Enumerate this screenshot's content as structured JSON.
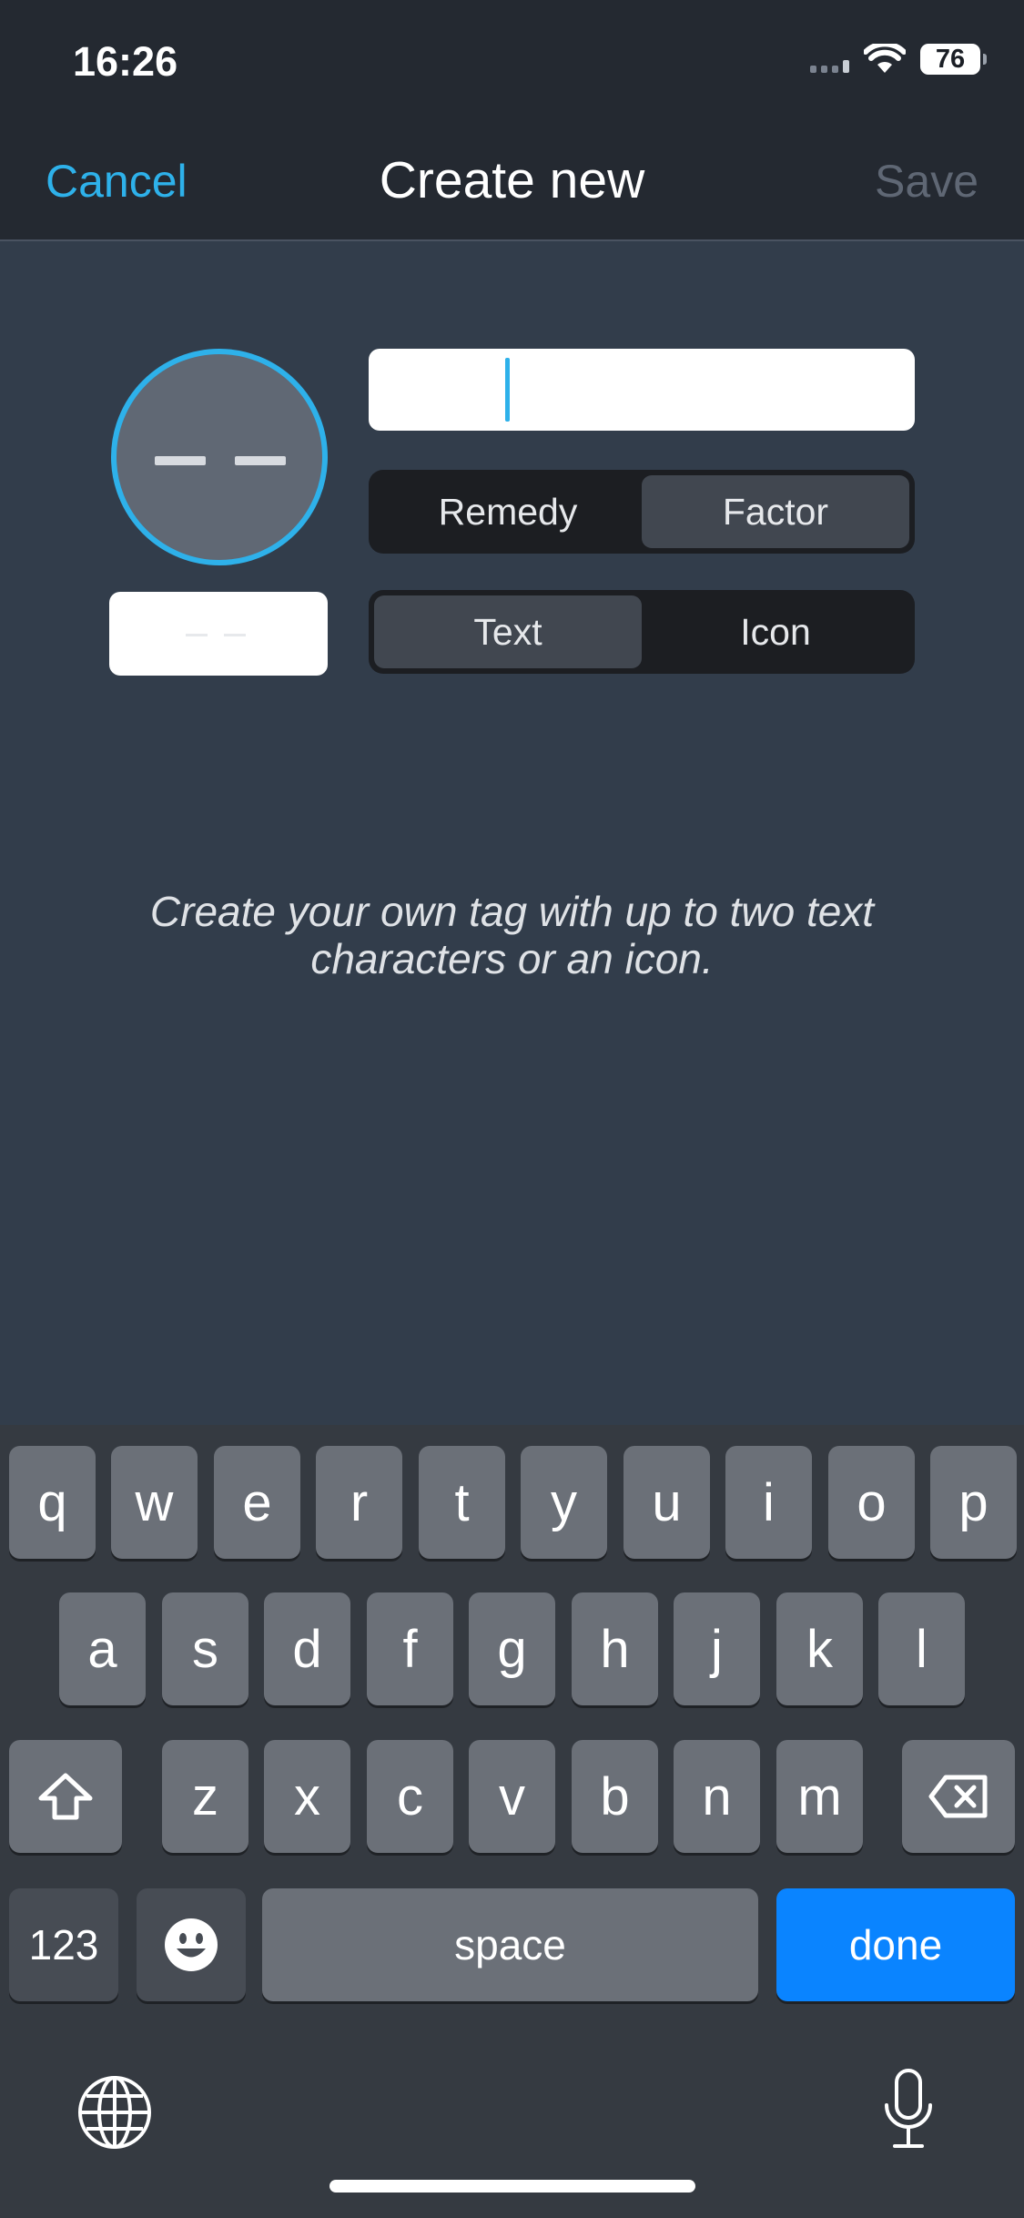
{
  "status": {
    "time": "16:26",
    "battery": "76"
  },
  "nav": {
    "cancel": "Cancel",
    "title": "Create new",
    "save": "Save"
  },
  "editor": {
    "name_value": "",
    "type_options": [
      "Remedy",
      "Factor"
    ],
    "type_selected": "Factor",
    "mode_options": [
      "Text",
      "Icon"
    ],
    "mode_selected": "Text",
    "helper_line1": "Create your own tag with up to two text",
    "helper_line2": "characters or an icon."
  },
  "colors": {
    "accent": "#2eb1ea",
    "done_key": "#0a84ff",
    "background": "#323d4b"
  },
  "keyboard": {
    "row1": [
      "q",
      "w",
      "e",
      "r",
      "t",
      "y",
      "u",
      "i",
      "o",
      "p"
    ],
    "row2": [
      "a",
      "s",
      "d",
      "f",
      "g",
      "h",
      "j",
      "k",
      "l"
    ],
    "row3": [
      "z",
      "x",
      "c",
      "v",
      "b",
      "n",
      "m"
    ],
    "numbers": "123",
    "space": "space",
    "done": "done",
    "icons": [
      "shift-icon",
      "delete-icon",
      "emoji-icon",
      "globe-icon",
      "microphone-icon"
    ]
  }
}
